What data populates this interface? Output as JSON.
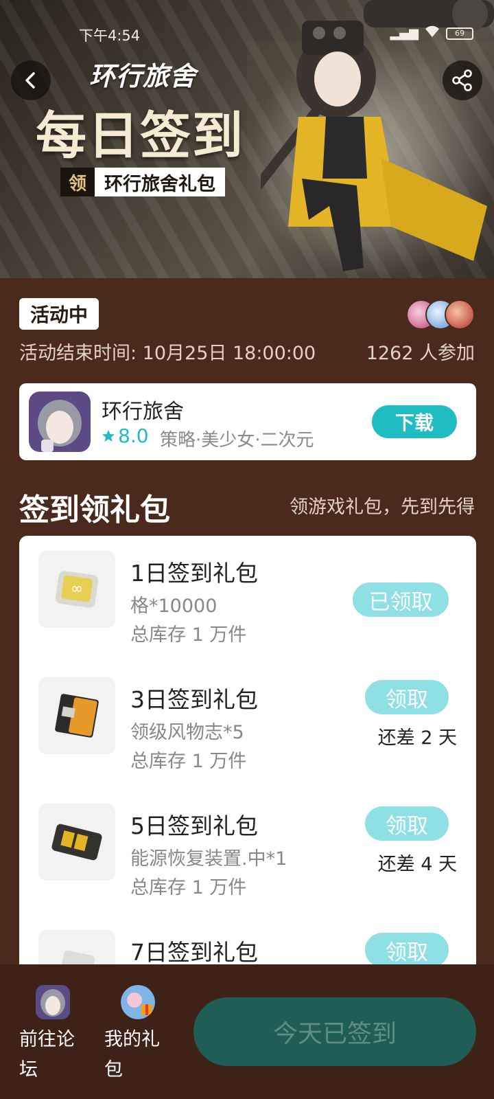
{
  "status_bar": {
    "time": "下午4:54",
    "battery": "69"
  },
  "hero": {
    "game_logo": "环行旅舍",
    "title": "每日签到",
    "tag_prefix": "领",
    "tag_text": "环行旅舍礼包"
  },
  "event": {
    "status_badge": "活动中",
    "end_time": "活动结束时间: 10月25日 18:00:00",
    "participants": "1262 人参加"
  },
  "game": {
    "name": "环行旅舍",
    "rating": "8.0",
    "tags": "策略·美少女·二次元",
    "download_label": "下载"
  },
  "section": {
    "title": "签到领礼包",
    "subtitle": "领游戏礼包，先到先得"
  },
  "gifts": [
    {
      "name": "1日签到礼包",
      "content": "格*10000",
      "stock": "总库存 1 万件",
      "button": "已领取",
      "remaining": ""
    },
    {
      "name": "3日签到礼包",
      "content": "领级风物志*5",
      "stock": "总库存 1 万件",
      "button": "领取",
      "remaining": "还差 2 天"
    },
    {
      "name": "5日签到礼包",
      "content": "能源恢复装置.中*1",
      "stock": "总库存 1 万件",
      "button": "领取",
      "remaining": "还差 4 天"
    },
    {
      "name": "7日签到礼包",
      "content": "",
      "stock": "",
      "button": "领取",
      "remaining": ""
    }
  ],
  "bottom": {
    "forum_label": "前往论坛",
    "my_gifts_label": "我的礼包",
    "checkin_label": "今天已签到"
  },
  "colors": {
    "accent": "#1fbcc4",
    "background": "#4a2a1c",
    "button_disabled": "#8fe0e4",
    "checkin_button": "#1f5e57"
  },
  "icons": [
    "back-icon",
    "share-icon",
    "star-icon",
    "wifi-icon",
    "signal-icon"
  ]
}
